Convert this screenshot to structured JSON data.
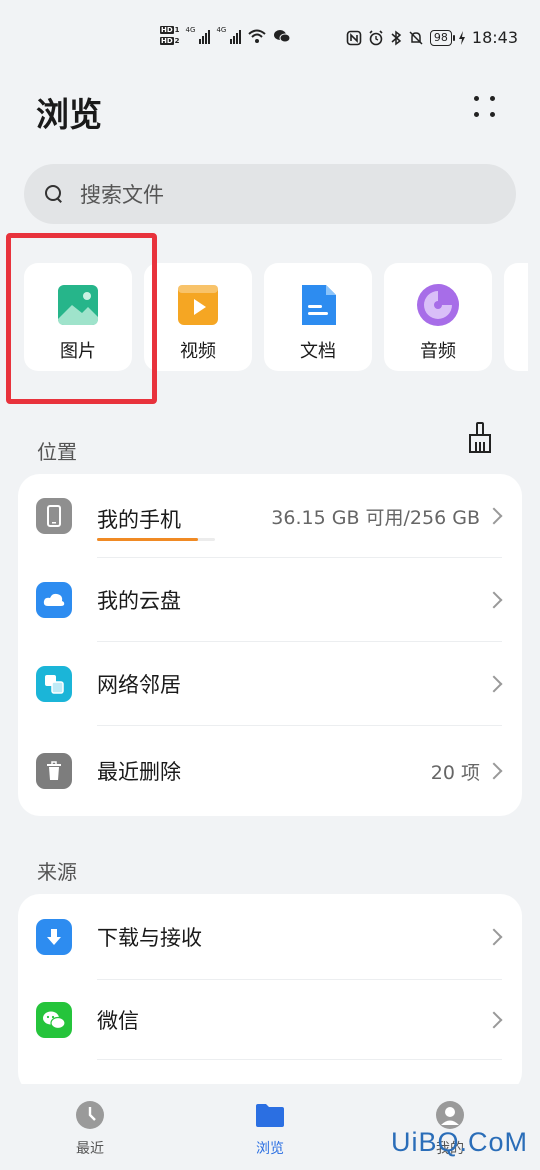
{
  "status_bar": {
    "hd1": "HD",
    "hd1_num": "1",
    "hd2": "HD",
    "hd2_num": "2",
    "net1": "4G",
    "net2": "4G",
    "battery": "98",
    "time": "18:43"
  },
  "header": {
    "title": "浏览",
    "search_placeholder": "搜索文件"
  },
  "categories": [
    {
      "label": "图片",
      "icon": "image-icon",
      "color": "#26b58a"
    },
    {
      "label": "视频",
      "icon": "video-icon",
      "color": "#f5a623"
    },
    {
      "label": "文档",
      "icon": "document-icon",
      "color": "#2d8cf0"
    },
    {
      "label": "音频",
      "icon": "audio-icon",
      "color": "#a76de8"
    }
  ],
  "location": {
    "section_label": "位置",
    "items": [
      {
        "label": "我的手机",
        "meta": "36.15 GB 可用/256 GB",
        "icon": "phone-icon",
        "usage_fraction": 0.86
      },
      {
        "label": "我的云盘",
        "meta": "",
        "icon": "cloud-icon"
      },
      {
        "label": "网络邻居",
        "meta": "",
        "icon": "network-icon"
      },
      {
        "label": "最近删除",
        "meta": "20 项",
        "icon": "trash-icon"
      }
    ]
  },
  "source": {
    "section_label": "来源",
    "items": [
      {
        "label": "下载与接收",
        "icon": "download-icon"
      },
      {
        "label": "微信",
        "icon": "wechat-icon"
      }
    ]
  },
  "bottom_nav": [
    {
      "label": "最近",
      "icon": "clock-icon",
      "active": false
    },
    {
      "label": "浏览",
      "icon": "folder-icon",
      "active": true
    },
    {
      "label": "我的",
      "icon": "user-icon",
      "active": false
    }
  ],
  "colors": {
    "accent": "#2b6fe2",
    "highlight_box": "#e8323c",
    "storage_bar": "#f08a24"
  },
  "watermark": "UiBQ.CoM"
}
